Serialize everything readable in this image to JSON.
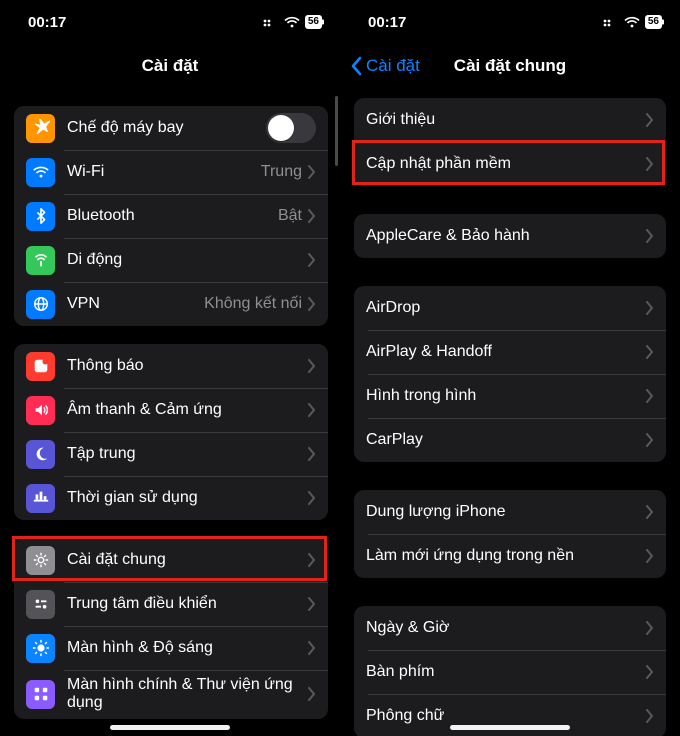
{
  "status": {
    "time": "00:17",
    "battery": "56"
  },
  "left": {
    "title": "Cài đặt",
    "groups": [
      {
        "rows": [
          {
            "icon": "airplane-icon",
            "label": "Chế độ máy bay",
            "control": "toggle"
          },
          {
            "icon": "wifi-icon",
            "label": "Wi-Fi",
            "value": "Trung",
            "chevron": true
          },
          {
            "icon": "bluetooth-icon",
            "label": "Bluetooth",
            "value": "Bật",
            "chevron": true
          },
          {
            "icon": "cellular-icon",
            "label": "Di động",
            "chevron": true
          },
          {
            "icon": "vpn-icon",
            "label": "VPN",
            "value": "Không kết nối",
            "chevron": true
          }
        ]
      },
      {
        "rows": [
          {
            "icon": "notifications-icon",
            "label": "Thông báo",
            "chevron": true
          },
          {
            "icon": "sounds-icon",
            "label": "Âm thanh & Cảm ứng",
            "chevron": true
          },
          {
            "icon": "focus-icon",
            "label": "Tập trung",
            "chevron": true
          },
          {
            "icon": "screentime-icon",
            "label": "Thời gian sử dụng",
            "chevron": true
          }
        ]
      },
      {
        "rows": [
          {
            "icon": "general-icon",
            "label": "Cài đặt chung",
            "chevron": true,
            "highlight": true
          },
          {
            "icon": "controlcenter-icon",
            "label": "Trung tâm điều khiển",
            "chevron": true
          },
          {
            "icon": "display-icon",
            "label": "Màn hình & Độ sáng",
            "chevron": true
          },
          {
            "icon": "homescreen-icon",
            "label": "Màn hình chính & Thư viện ứng dụng",
            "chevron": true
          }
        ]
      }
    ]
  },
  "right": {
    "back": "Cài đặt",
    "title": "Cài đặt chung",
    "groups": [
      {
        "rows": [
          {
            "label": "Giới thiệu",
            "chevron": true
          },
          {
            "label": "Cập nhật phần mềm",
            "chevron": true,
            "highlight": true
          }
        ]
      },
      {
        "rows": [
          {
            "label": "AppleCare & Bảo hành",
            "chevron": true
          }
        ]
      },
      {
        "rows": [
          {
            "label": "AirDrop",
            "chevron": true
          },
          {
            "label": "AirPlay & Handoff",
            "chevron": true
          },
          {
            "label": "Hình trong hình",
            "chevron": true
          },
          {
            "label": "CarPlay",
            "chevron": true
          }
        ]
      },
      {
        "rows": [
          {
            "label": "Dung lượng iPhone",
            "chevron": true
          },
          {
            "label": "Làm mới ứng dụng trong nền",
            "chevron": true
          }
        ]
      },
      {
        "rows": [
          {
            "label": "Ngày & Giờ",
            "chevron": true
          },
          {
            "label": "Bàn phím",
            "chevron": true
          },
          {
            "label": "Phông chữ",
            "chevron": true
          }
        ]
      }
    ]
  }
}
